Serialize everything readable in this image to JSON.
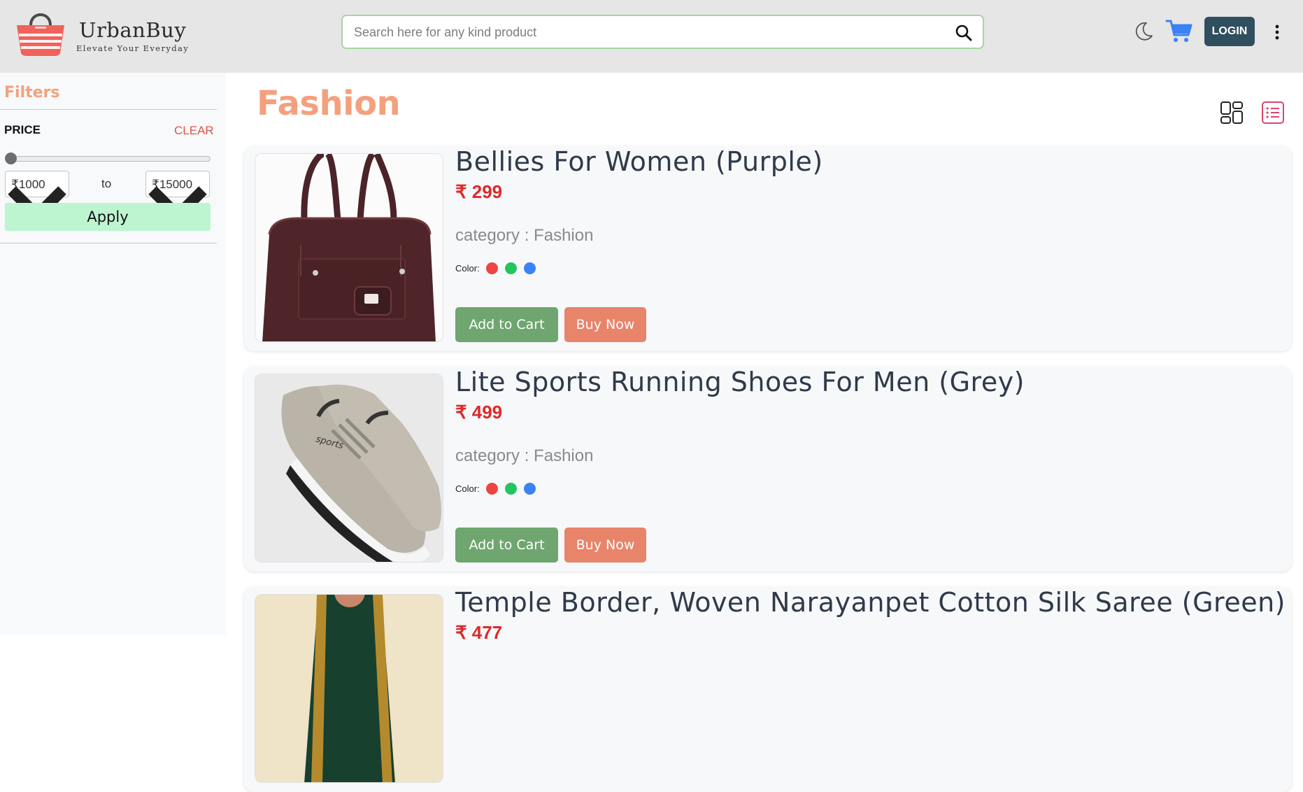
{
  "header": {
    "brand_name": "UrbanBuy",
    "brand_tagline": "Elevate Your Everyday",
    "search_placeholder": "Search here for any kind product",
    "login_label": "LOGIN"
  },
  "sidebar": {
    "title": "Filters",
    "price_label": "PRICE",
    "clear_label": "CLEAR",
    "price_min": "₹1000",
    "price_max": "₹15000",
    "to_label": "to",
    "apply_label": "Apply",
    "slider_value_fraction": 0
  },
  "main": {
    "title": "Fashion",
    "products": [
      {
        "title": "Bellies For Women (Purple)",
        "price": "₹ 299",
        "category": "category : Fashion",
        "color_label": "Color:",
        "colors": [
          "#ef4444",
          "#22c55e",
          "#3b82f6"
        ],
        "image_icon": "handbag-image",
        "add_to_cart": "Add to Cart",
        "buy_now": "Buy Now"
      },
      {
        "title": "Lite Sports Running Shoes For Men (Grey)",
        "price": "₹ 499",
        "category": "category : Fashion",
        "color_label": "Color:",
        "colors": [
          "#ef4444",
          "#22c55e",
          "#3b82f6"
        ],
        "image_icon": "sneaker-image",
        "add_to_cart": "Add to Cart",
        "buy_now": "Buy Now"
      },
      {
        "title": "Temple Border, Woven Narayanpet Cotton Silk Saree (Green)",
        "price": "₹ 477",
        "image_icon": "saree-image"
      }
    ]
  },
  "colors": {
    "accent": "#f4a07e",
    "price": "#dd2a2a",
    "add_to_cart_bg": "#6fa66f",
    "buy_now_bg": "#e8846a",
    "login_bg": "#2f4f5f",
    "apply_bg": "#bdf5d0"
  }
}
